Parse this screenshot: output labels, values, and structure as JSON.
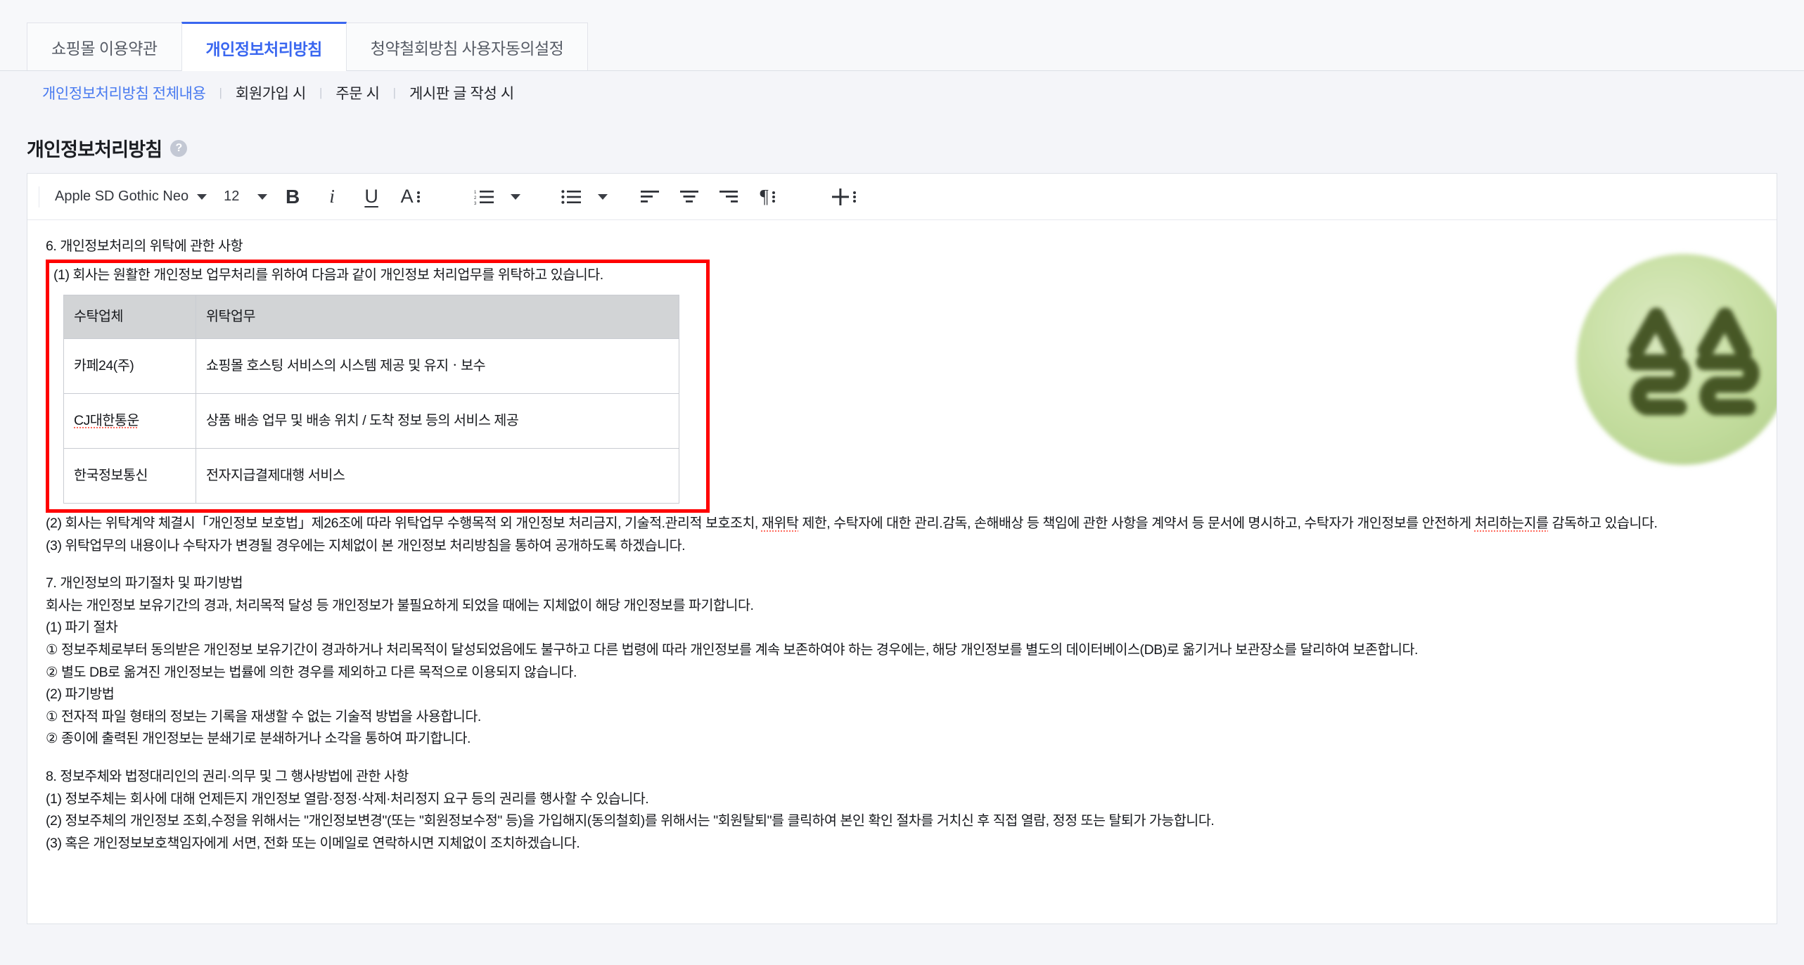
{
  "tabs": [
    {
      "label": "쇼핑몰 이용약관",
      "active": false
    },
    {
      "label": "개인정보처리방침",
      "active": true
    },
    {
      "label": "청약철회방침 사용자동의설정",
      "active": false
    }
  ],
  "subnav": {
    "items": [
      {
        "label": "개인정보처리방침 전체내용",
        "active": true
      },
      {
        "label": "회원가입 시",
        "active": false
      },
      {
        "label": "주문 시",
        "active": false
      },
      {
        "label": "게시판 글 작성 시",
        "active": false
      }
    ],
    "separator": "|"
  },
  "page": {
    "title": "개인정보처리방침",
    "help_icon_label": "?"
  },
  "toolbar": {
    "font_family_value": "Apple SD Gothic Neo",
    "font_size_value": "12",
    "bold_label": "B",
    "italic_label": "i",
    "underline_label": "U",
    "text_color_label": "A",
    "ordered_list_name": "ordered-list",
    "unordered_list_name": "unordered-list",
    "align_left_name": "align-left",
    "align_center_name": "align-center",
    "align_right_name": "align-right",
    "paragraph_label": "¶",
    "insert_label": "+"
  },
  "document": {
    "section6_heading": "6. 개인정보처리의 위탁에 관한 사항",
    "section6_p1": "(1) 회사는 원활한 개인정보 업무처리를 위하여 다음과 같이 개인정보 처리업무를 위탁하고 있습니다.",
    "table": {
      "headers": [
        "수탁업체",
        "위탁업무"
      ],
      "rows": [
        {
          "company": "카페24(주)",
          "task": "쇼핑몰 호스팅 서비스의 시스템 제공 및 유지ㆍ보수",
          "misspelled": false
        },
        {
          "company": "CJ대한통운",
          "task": "상품 배송 업무 및 배송 위치 / 도착 정보 등의 서비스 제공",
          "misspelled": true
        },
        {
          "company": "한국정보통신",
          "task": "전자지급결제대행 서비스",
          "misspelled": false
        }
      ]
    },
    "section6_p2_a": "(2) 회사는 위탁계약 체결시「개인정보 보호법」제26조에 따라 위탁업무 수행목적 외 개인정보 처리금지, 기술적.관리적 보호조치, ",
    "section6_p2_err": "재위탁",
    "section6_p2_b": " 제한, 수탁자에 대한 관리.감독, 손해배상 등 책임에 관한 사항을 계약서 등 문서에 명시하고, 수탁자가 개인정보를 안전하게 ",
    "section6_p2_err2": "처리하는지를",
    "section6_p2_c": " 감독하고 있습니다.",
    "section6_p3": "(3) 위탁업무의 내용이나 수탁자가 변경될 경우에는 지체없이 본 개인정보 처리방침을 통하여 공개하도록 하겠습니다.",
    "section7_heading": "7. 개인정보의 파기절차 및 파기방법",
    "section7_intro": "회사는 개인정보 보유기간의 경과, 처리목적 달성 등 개인정보가 불필요하게 되었을 때에는 지체없이 해당 개인정보를 파기합니다.",
    "section7_s1_title": "(1) 파기 절차",
    "section7_s1_i1": "① 정보주체로부터 동의받은 개인정보 보유기간이 경과하거나 처리목적이 달성되었음에도 불구하고 다른 법령에 따라 개인정보를 계속 보존하여야 하는 경우에는, 해당 개인정보를 별도의 데이터베이스(DB)로 옮기거나 보관장소를 달리하여 보존합니다.",
    "section7_s1_i2": "② 별도 DB로 옮겨진 개인정보는 법률에 의한 경우를 제외하고 다른 목적으로 이용되지 않습니다.",
    "section7_s2_title": "(2) 파기방법",
    "section7_s2_i1": "① 전자적 파일 형태의 정보는 기록을 재생할 수 없는 기술적 방법을 사용합니다.",
    "section7_s2_i2": "② 종이에 출력된 개인정보는 분쇄기로 분쇄하거나 소각을 통하여 파기합니다.",
    "section8_heading": "8. 정보주체와 법정대리인의 권리·의무 및 그 행사방법에 관한 사항",
    "section8_p1": "(1) 정보주체는 회사에 대해 언제든지 개인정보 열람·정정·삭제·처리정지 요구 등의 권리를 행사할 수 있습니다.",
    "section8_p2": "(2) 정보주체의 개인정보 조회,수정을 위해서는 \"개인정보변경\"(또는 \"회원정보수정\" 등)을 가입해지(동의철회)를 위해서는 \"회원탈퇴\"를 클릭하여 본인 확인 절차를 거치신 후 직접 열람, 정정 또는 탈퇴가 가능합니다.",
    "section8_p3": "(3) 혹은 개인정보보호책임자에게 서면, 전화 또는 이메일로 연락하시면 지체없이 조치하겠습니다."
  },
  "watermark": {
    "text": "쓸쓸",
    "blob_color": "#c4dc9e",
    "glyph_color": "#3c4d1e"
  },
  "colors": {
    "accent": "#3a67f0",
    "highlight_box": "#ff0000",
    "page_bg": "#f4f5f9",
    "table_header_bg": "#d2d4d6",
    "spellcheck": "#ff6b5e"
  }
}
